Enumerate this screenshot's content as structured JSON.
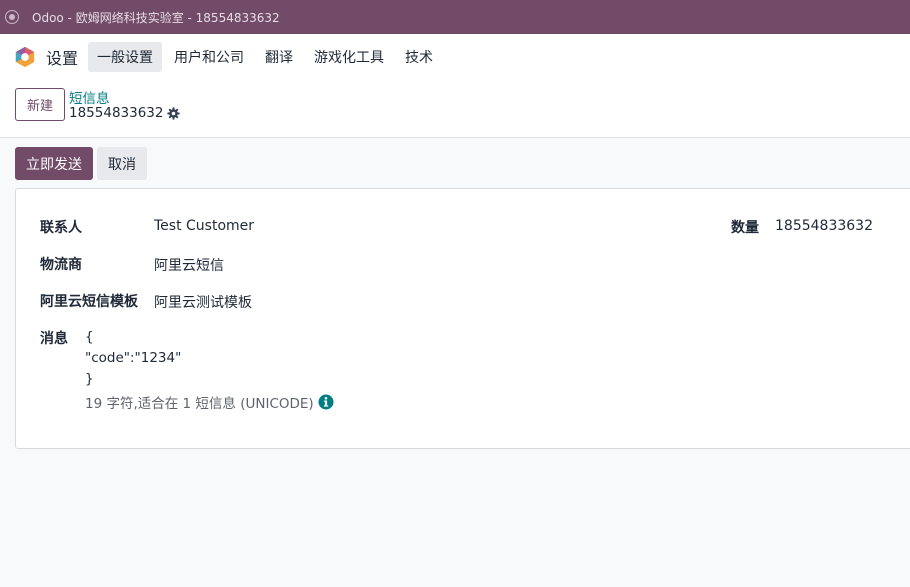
{
  "window": {
    "title": "Odoo - 欧姆网络科技实验室 - 18554833632"
  },
  "navbar": {
    "app_name": "设置",
    "menu": [
      "一般设置",
      "用户和公司",
      "翻译",
      "游戏化工具",
      "技术"
    ]
  },
  "control_panel": {
    "new_button": "新建",
    "breadcrumb": "短信息",
    "record_title": "18554833632"
  },
  "actions": {
    "send": "立即发送",
    "cancel": "取消"
  },
  "form": {
    "contact_label": "联系人",
    "contact_value": "Test Customer",
    "quantity_label": "数量",
    "quantity_value": "18554833632",
    "provider_label": "物流商",
    "provider_value": "阿里云短信",
    "template_label": "阿里云短信模板",
    "template_value": "阿里云测试模板",
    "message_label": "消息",
    "message_lines": [
      "{",
      "\"code\":\"1234\"",
      "}"
    ],
    "counter": "19 字符,适合在 1 短信息 (UNICODE)"
  },
  "colors": {
    "brand": "#714b67",
    "link": "#017e84"
  },
  "icons": {
    "settings": "gear-icon",
    "info": "info-icon",
    "app": "odoo-logo"
  }
}
